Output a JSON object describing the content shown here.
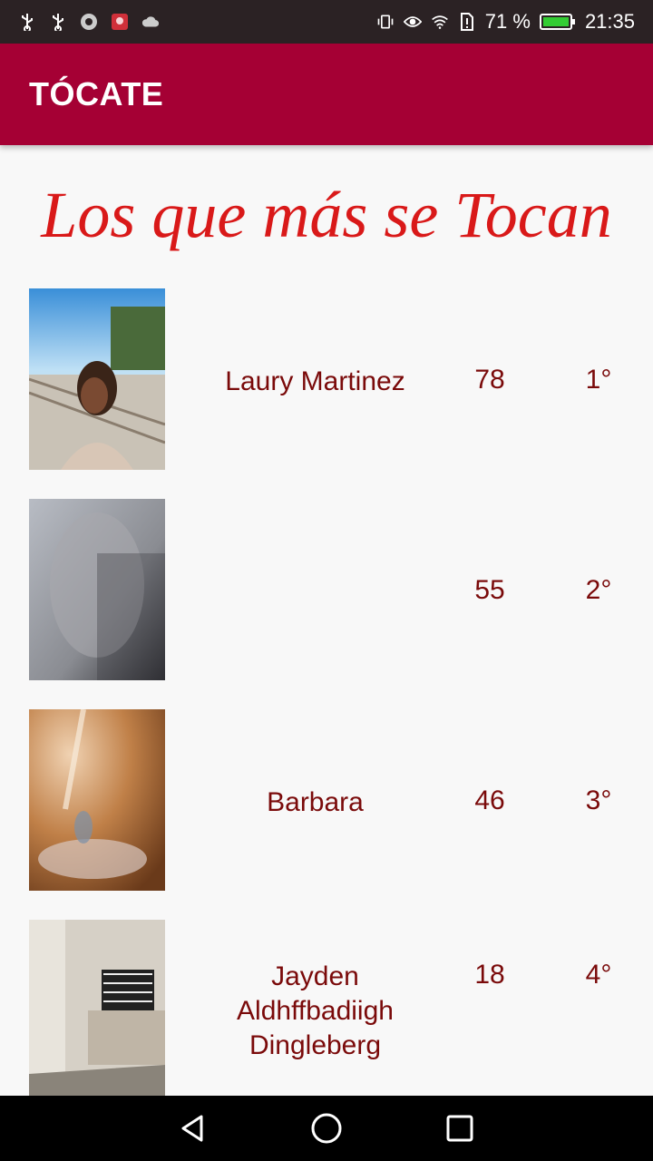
{
  "status_bar": {
    "battery_percent": "71 %",
    "time": "21:35"
  },
  "app_bar": {
    "title": "TÓCATE"
  },
  "headline": "Los que más se Tocan",
  "leaderboard": [
    {
      "name": "Laury Martinez",
      "score": "78",
      "rank": "1°"
    },
    {
      "name": "",
      "score": "55",
      "rank": "2°"
    },
    {
      "name": "Barbara",
      "score": "46",
      "rank": "3°"
    },
    {
      "name": "Jayden Aldhffbadiigh Dingleberg",
      "score": "18",
      "rank": "4°"
    }
  ],
  "colors": {
    "app_bar": "#a50034",
    "headline": "#d91919",
    "list_text": "#7a0a0a"
  }
}
